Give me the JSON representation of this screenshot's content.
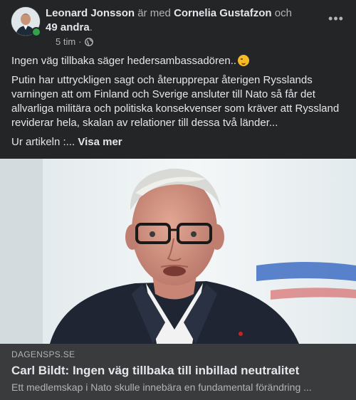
{
  "header": {
    "author": "Leonard Jonsson",
    "with_text": "är med",
    "tagged": "Cornelia Gustafzon",
    "and_text": "och",
    "others": "49 andra",
    "period": ".",
    "time": "5 tim",
    "dot": "·",
    "privacy_icon": "globe-icon",
    "more_icon": "more-options-icon",
    "more_label": "•••"
  },
  "post": {
    "line1": "Ingen väg tillbaka säger hedersambassadören..",
    "line1_emoji": "smirking-face-emoji",
    "paragraph": "Putin har uttryckligen sagt och återupprepar återigen Rysslands varningen att om Finland och Sverige ansluter till Nato så får det allvarliga militära och politiska konsekvenser som kräver att Ryssland reviderar hela, skalan av relationer till dessa två länder...",
    "source_prefix": "Ur artikeln :...",
    "see_more": "Visa mer"
  },
  "link": {
    "source": "DAGENSPS.SE",
    "title": "Carl Bildt: Ingen väg tillbaka till inbillad neutralitet",
    "description": "Ett medlemskap i Nato skulle innebära en fundamental förändring ..."
  },
  "colors": {
    "background": "#242526",
    "link_box": "#3a3b3c",
    "primary_text": "#e4e6eb",
    "secondary_text": "#b0b3b8",
    "online": "#31a24c"
  }
}
